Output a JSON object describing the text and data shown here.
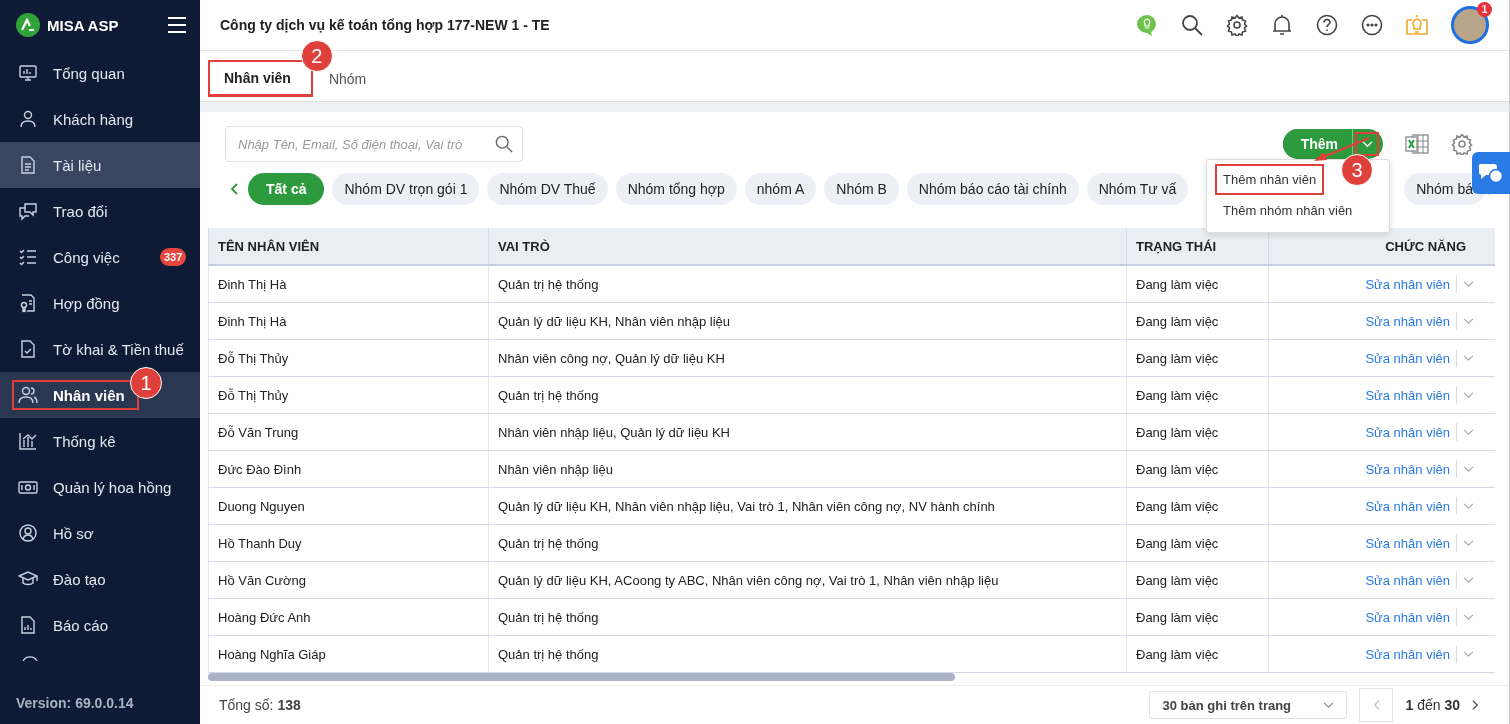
{
  "sidebar": {
    "brand": "MISA ASP",
    "items": [
      {
        "label": "Tổng quan",
        "selected": false,
        "hover": false
      },
      {
        "label": "Khách hàng",
        "selected": false,
        "hover": false
      },
      {
        "label": "Tài liệu",
        "selected": false,
        "hover": true
      },
      {
        "label": "Trao đổi",
        "selected": false,
        "hover": false
      },
      {
        "label": "Công việc",
        "selected": false,
        "hover": false,
        "badge": "337"
      },
      {
        "label": "Hợp đồng",
        "selected": false,
        "hover": false
      },
      {
        "label": "Tờ khai & Tiền thuế",
        "selected": false,
        "hover": false
      },
      {
        "label": "Nhân viên",
        "selected": true,
        "hover": false,
        "highlighted": true,
        "callout": "1"
      },
      {
        "label": "Thống kê",
        "selected": false,
        "hover": false
      },
      {
        "label": "Quản lý hoa hồng",
        "selected": false,
        "hover": false
      },
      {
        "label": "Hồ sơ",
        "selected": false,
        "hover": false
      },
      {
        "label": "Đào tạo",
        "selected": false,
        "hover": false
      },
      {
        "label": "Báo cáo",
        "selected": false,
        "hover": false
      }
    ],
    "version": "Version: 69.0.0.14"
  },
  "header": {
    "title": "Công ty dịch vụ kế toán tổng hợp 177-NEW 1 - TE",
    "avatar_badge": "1"
  },
  "tabs": [
    {
      "label": "Nhân viên",
      "selected": true,
      "highlighted": true,
      "callout": "2"
    },
    {
      "label": "Nhóm",
      "selected": false
    }
  ],
  "search": {
    "placeholder": "Nhập Tên, Email, Số điện thoại, Vai trò"
  },
  "add_button": {
    "label": "Thêm",
    "toggle_highlighted": true
  },
  "add_menu": {
    "items": [
      {
        "label": "Thêm nhân viên",
        "highlighted": true,
        "callout": "3"
      },
      {
        "label": "Thêm nhóm nhân viên",
        "highlighted": false
      }
    ]
  },
  "chips": [
    {
      "label": "Tất cả",
      "selected": true
    },
    {
      "label": "Nhóm DV trọn gói 1",
      "selected": false
    },
    {
      "label": "Nhóm DV Thuế",
      "selected": false
    },
    {
      "label": "Nhóm tổng hợp",
      "selected": false
    },
    {
      "label": "nhóm A",
      "selected": false
    },
    {
      "label": "Nhóm B",
      "selected": false
    },
    {
      "label": "Nhóm báo cáo tài chính",
      "selected": false
    },
    {
      "label": "Nhóm Tư vấ",
      "selected": false
    },
    {
      "label": "Nhóm bá",
      "selected": false
    }
  ],
  "table": {
    "columns": [
      "TÊN NHÂN VIÊN",
      "VAI TRÒ",
      "TRẠNG THÁI",
      "CHỨC NĂNG"
    ],
    "rows": [
      {
        "name": "Đinh Thị Hà",
        "role": "Quản trị hệ thống",
        "status": "Đang làm việc",
        "action": "Sửa nhân viên"
      },
      {
        "name": "Đinh Thị Hà",
        "role": "Quản lý dữ liệu KH, Nhân viên nhập liệu",
        "status": "Đang làm việc",
        "action": "Sửa nhân viên"
      },
      {
        "name": "Đỗ Thị Thủy",
        "role": "Nhân viên công nợ, Quản lý dữ liệu KH",
        "status": "Đang làm việc",
        "action": "Sửa nhân viên"
      },
      {
        "name": "Đỗ Thị Thủy",
        "role": "Quản trị hệ thống",
        "status": "Đang làm việc",
        "action": "Sửa nhân viên"
      },
      {
        "name": "Đỗ Văn Trung",
        "role": "Nhân viên nhập liệu, Quản lý dữ liệu KH",
        "status": "Đang làm việc",
        "action": "Sửa nhân viên"
      },
      {
        "name": "Đức Đào Đình",
        "role": "Nhân viên nhập liệu",
        "status": "Đang làm việc",
        "action": "Sửa nhân viên"
      },
      {
        "name": "Duong Nguyen",
        "role": "Quản lý dữ liệu KH, Nhân viên nhập liệu, Vai trò 1, Nhân viên công nợ, NV hành chính",
        "status": "Đang làm việc",
        "action": "Sửa nhân viên"
      },
      {
        "name": "Hồ Thanh Duy",
        "role": "Quản trị hệ thống",
        "status": "Đang làm việc",
        "action": "Sửa nhân viên"
      },
      {
        "name": "Hồ Văn Cường",
        "role": "Quản lý dữ liệu KH, ACoong ty ABC, Nhân viên công nợ, Vai trò 1, Nhân viên nhập liệu",
        "status": "Đang làm việc",
        "action": "Sửa nhân viên"
      },
      {
        "name": "Hoàng Đức Anh",
        "role": "Quản trị hệ thống",
        "status": "Đang làm việc",
        "action": "Sửa nhân viên"
      },
      {
        "name": "Hoàng Nghĩa Giáp",
        "role": "Quản trị hệ thống",
        "status": "Đang làm việc",
        "action": "Sửa nhân viên"
      }
    ]
  },
  "footer": {
    "total": "Tổng số: **138**",
    "page_size": "30 bản ghi trên trang",
    "range": "**1** đến **30**"
  }
}
